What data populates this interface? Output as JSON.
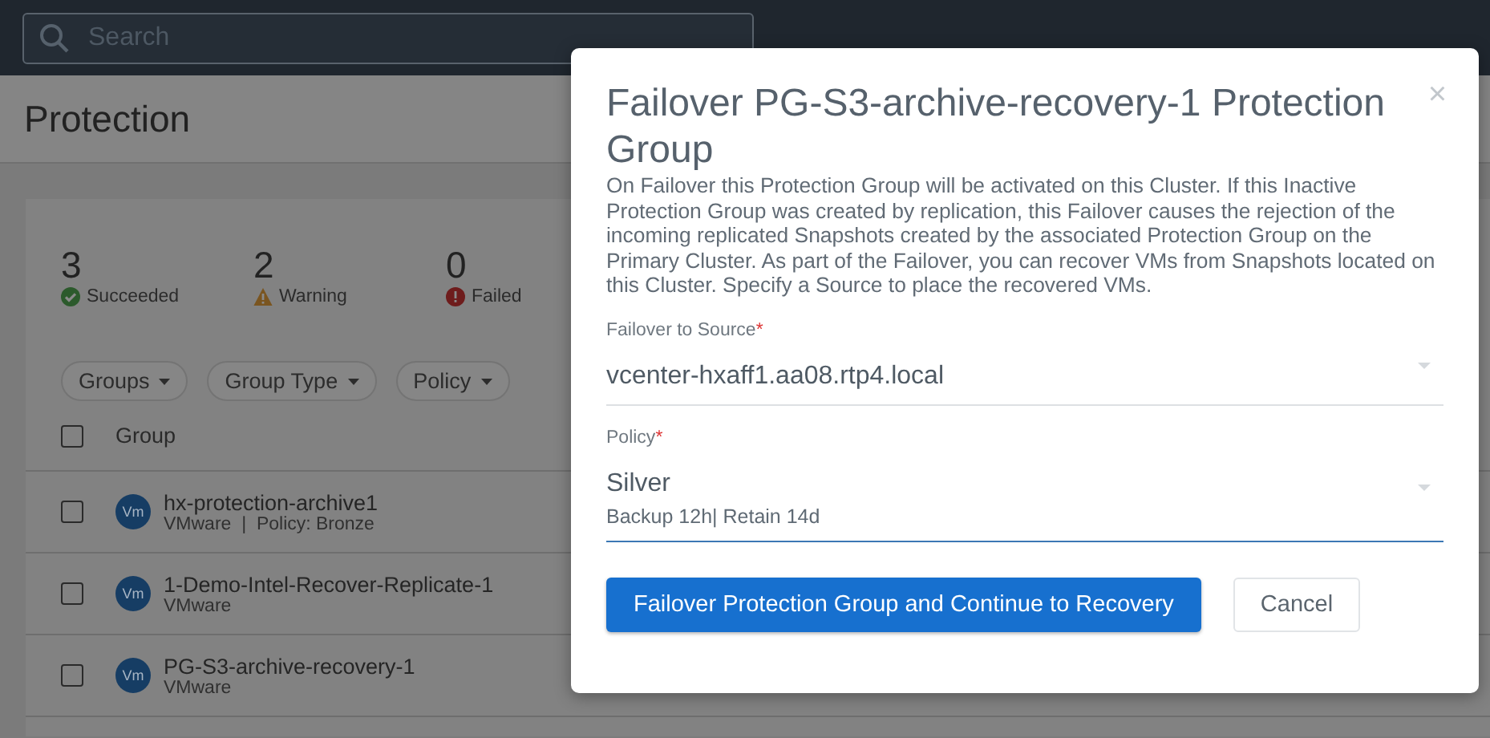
{
  "search": {
    "placeholder": "Search"
  },
  "page_title": "Protection",
  "stats": [
    {
      "count": "3",
      "label": "Succeeded",
      "kind": "success"
    },
    {
      "count": "2",
      "label": "Warning",
      "kind": "warning"
    },
    {
      "count": "0",
      "label": "Failed",
      "kind": "failed"
    }
  ],
  "filters": [
    "Groups",
    "Group Type",
    "Policy"
  ],
  "table": {
    "select_all": {
      "checked": false
    },
    "columns": [
      "Group"
    ],
    "rows": [
      {
        "badge": "Vm",
        "name": "hx-protection-archive1",
        "subtitle": "VMware  |  Policy: Bronze",
        "checked": false
      },
      {
        "badge": "Vm",
        "name": "1-Demo-Intel-Recover-Replicate-1",
        "subtitle": "VMware",
        "checked": false
      },
      {
        "badge": "Vm",
        "name": "PG-S3-archive-recovery-1",
        "subtitle": "VMware",
        "checked": false
      }
    ]
  },
  "dialog": {
    "title": "Failover PG-S3-archive-recovery-1 Protection Group",
    "close": "×",
    "description": "On Failover this Protection Group will be activated on this Cluster. If this Inactive Protection Group was created by replication, this Failover causes the rejection of the incoming replicated Snapshots created by the associated Protection Group on the Primary Cluster. As part of the Failover, you can recover VMs from Snapshots located on this Cluster. Specify a Source to place the recovered VMs.",
    "fields": [
      {
        "label": "Failover to Source",
        "required_mark": "*",
        "value": "vcenter-hxaff1.aa08.rtp4.local",
        "focused": false
      },
      {
        "label": "Policy",
        "required_mark": "*",
        "value": "Silver",
        "detail": "Backup 12h| Retain 14d",
        "focused": true
      }
    ],
    "buttons": [
      {
        "label": "Failover Protection Group and Continue to Recovery",
        "kind": "primary"
      },
      {
        "label": "Cancel",
        "kind": "secondary"
      }
    ]
  }
}
